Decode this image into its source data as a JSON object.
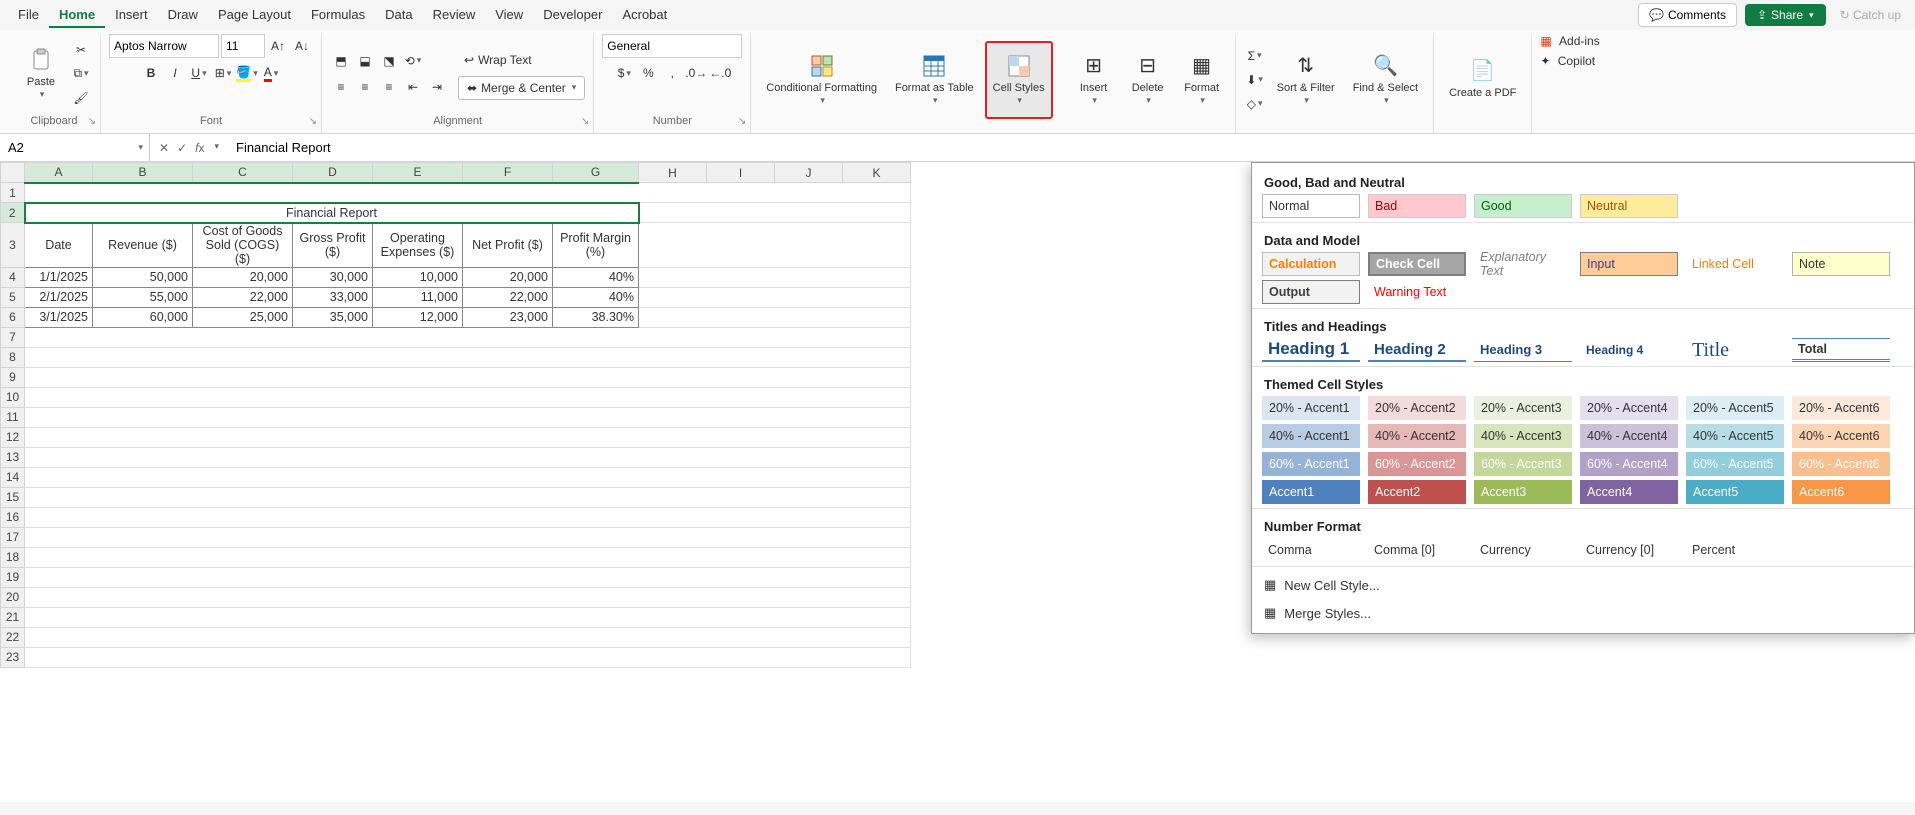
{
  "tabs": [
    "File",
    "Home",
    "Insert",
    "Draw",
    "Page Layout",
    "Formulas",
    "Data",
    "Review",
    "View",
    "Developer",
    "Acrobat"
  ],
  "active_tab": "Home",
  "header_buttons": {
    "comments": "Comments",
    "share": "Share",
    "catchup": "Catch up"
  },
  "ribbon": {
    "clipboard": {
      "label": "Clipboard",
      "paste": "Paste"
    },
    "font": {
      "label": "Font",
      "name": "Aptos Narrow",
      "size": "11"
    },
    "alignment": {
      "label": "Alignment",
      "wrap": "Wrap Text",
      "merge": "Merge & Center"
    },
    "number": {
      "label": "Number",
      "format": "General"
    },
    "styles": {
      "conditional": "Conditional Formatting",
      "table": "Format as Table",
      "cell": "Cell Styles"
    },
    "cells": {
      "insert": "Insert",
      "delete": "Delete",
      "format": "Format"
    },
    "editing": {
      "sort": "Sort & Filter",
      "find": "Find & Select"
    },
    "pdf": {
      "create": "Create a PDF"
    },
    "addins": {
      "addins": "Add-ins",
      "copilot": "Copilot"
    }
  },
  "namebox": "A2",
  "formula": "Financial Report",
  "columns": [
    "A",
    "B",
    "C",
    "D",
    "E",
    "F",
    "G",
    "H",
    "I",
    "J",
    "K"
  ],
  "sheet": {
    "title": "Financial Report",
    "headers": [
      "Date",
      "Revenue ($)",
      "Cost of Goods Sold (COGS) ($)",
      "Gross Profit ($)",
      "Operating Expenses ($)",
      "Net Profit ($)",
      "Profit Margin (%)"
    ],
    "rows": [
      [
        "1/1/2025",
        "50,000",
        "20,000",
        "30,000",
        "10,000",
        "20,000",
        "40%"
      ],
      [
        "2/1/2025",
        "55,000",
        "22,000",
        "33,000",
        "11,000",
        "22,000",
        "40%"
      ],
      [
        "3/1/2025",
        "60,000",
        "25,000",
        "35,000",
        "12,000",
        "23,000",
        "38.30%"
      ]
    ]
  },
  "styles_panel": {
    "sec1": "Good, Bad and Neutral",
    "normal": "Normal",
    "bad": "Bad",
    "good": "Good",
    "neutral": "Neutral",
    "sec2": "Data and Model",
    "calc": "Calculation",
    "check": "Check Cell",
    "explan": "Explanatory Text",
    "input": "Input",
    "linked": "Linked Cell",
    "note": "Note",
    "output": "Output",
    "warn": "Warning Text",
    "sec3": "Titles and Headings",
    "h1": "Heading 1",
    "h2": "Heading 2",
    "h3": "Heading 3",
    "h4": "Heading 4",
    "title": "Title",
    "total": "Total",
    "sec4": "Themed Cell Styles",
    "accents": [
      {
        "pct": "20%",
        "colors": [
          "#dce6f1",
          "#f2dcdb",
          "#ebf1de",
          "#e4dfec",
          "#daeef3",
          "#fde9d9"
        ],
        "txt": "#333"
      },
      {
        "pct": "40%",
        "colors": [
          "#b8cce4",
          "#e6b8b7",
          "#d8e4bc",
          "#ccc0da",
          "#b7dee8",
          "#fcd5b4"
        ],
        "txt": "#333"
      },
      {
        "pct": "60%",
        "colors": [
          "#95b3d7",
          "#da9694",
          "#c4d79b",
          "#b1a0c7",
          "#92cddc",
          "#fabf8f"
        ],
        "txt": "#fff"
      },
      {
        "pct": "",
        "colors": [
          "#4f81bd",
          "#c0504d",
          "#9bbb59",
          "#8064a2",
          "#4bacc6",
          "#f79646"
        ],
        "txt": "#fff"
      }
    ],
    "sec5": "Number Format",
    "comma": "Comma",
    "comma0": "Comma [0]",
    "currency": "Currency",
    "currency0": "Currency [0]",
    "percent": "Percent",
    "new_style": "New Cell Style...",
    "merge_styles": "Merge Styles..."
  }
}
